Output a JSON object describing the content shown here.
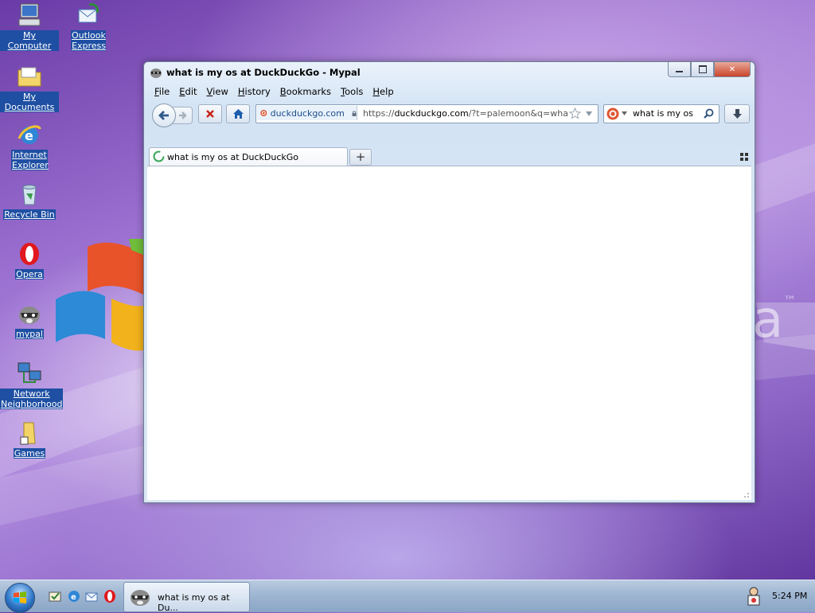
{
  "desktop": {
    "icons": [
      {
        "label": "My Computer",
        "icon": "computer-icon"
      },
      {
        "label": "Outlook Express",
        "icon": "outlook-express-icon"
      },
      {
        "label": "My Documents",
        "icon": "folder-icon"
      },
      {
        "label": "Internet Explorer",
        "icon": "internet-explorer-icon"
      },
      {
        "label": "Recycle Bin",
        "icon": "recycle-bin-icon"
      },
      {
        "label": "Opera",
        "icon": "opera-icon"
      },
      {
        "label": "mypal",
        "icon": "mypal-raccoon-icon"
      },
      {
        "label": "Network Neighborhood",
        "icon": "network-icon"
      },
      {
        "label": "Games",
        "icon": "games-folder-icon"
      }
    ]
  },
  "browser": {
    "title": "what is my os at DuckDuckGo - Mypal",
    "menu": [
      {
        "label": "File",
        "key": "F",
        "rest": "ile"
      },
      {
        "label": "Edit",
        "key": "E",
        "rest": "dit"
      },
      {
        "label": "View",
        "key": "V",
        "rest": "iew"
      },
      {
        "label": "History",
        "key": "H",
        "rest": "istory"
      },
      {
        "label": "Bookmarks",
        "key": "B",
        "rest": "ookmarks"
      },
      {
        "label": "Tools",
        "key": "T",
        "rest": "ools"
      },
      {
        "label": "Help",
        "key": "H",
        "rest": "elp"
      }
    ],
    "identity_site": "duckduckgo.com",
    "url_prefix": "https://",
    "url_host": "duckduckgo.com",
    "url_rest": "/?t=palemoon&q=what+is+",
    "search_value": "what is my os",
    "tab_title": "what is my os at DuckDuckGo",
    "new_tab_label": "+"
  },
  "taskbar": {
    "task_title": "what is my os at Du...",
    "clock": "5:24 PM"
  },
  "colors": {
    "label_bg": "#1e4fa3",
    "close_red": "#c9442b",
    "ddg_orange": "#de5833",
    "stop_red": "#c8261c",
    "home_blue": "#1f5fae"
  }
}
